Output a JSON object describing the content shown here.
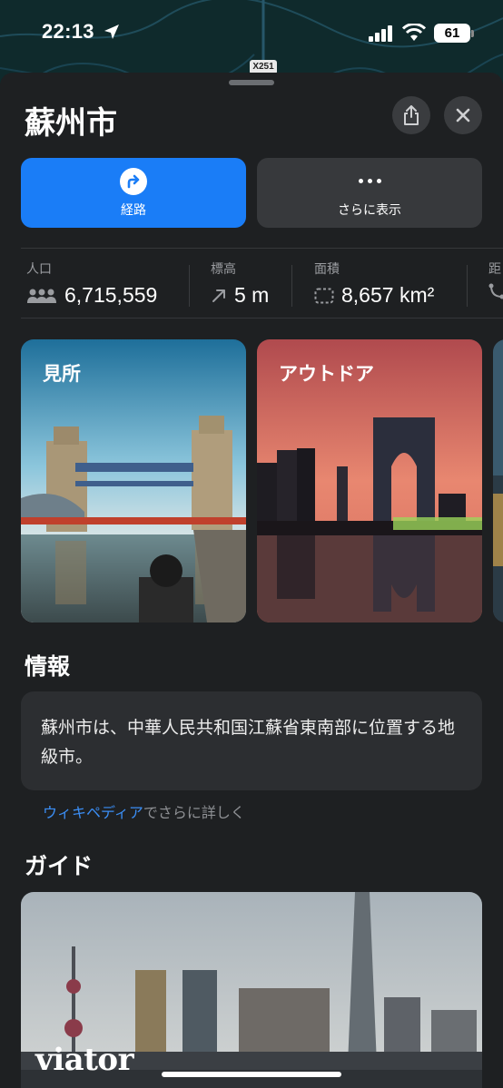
{
  "status_bar": {
    "time": "22:13",
    "battery": "61"
  },
  "map": {
    "route_shield": "X251"
  },
  "place": {
    "name": "蘇州市"
  },
  "actions": {
    "directions_label": "経路",
    "more_label": "さらに表示"
  },
  "stats": [
    {
      "key": "人口",
      "value": "6,715,559",
      "icon": "people-icon"
    },
    {
      "key": "標高",
      "value": "5 m",
      "icon": "elevation-arrow-icon"
    },
    {
      "key": "面積",
      "value": "8,657 km²",
      "icon": "area-icon"
    },
    {
      "key": "距",
      "value": "",
      "icon": "distance-icon"
    }
  ],
  "cards": [
    {
      "caption": "見所"
    },
    {
      "caption": "アウトドア"
    }
  ],
  "info": {
    "heading": "情報",
    "text": "蘇州市は、中華人民共和国江蘇省東南部に位置する地級市。",
    "wiki_link": "ウィキペディア",
    "wiki_suffix": "でさらに詳しく"
  },
  "guide": {
    "heading": "ガイド",
    "brand": "viator"
  },
  "colors": {
    "accent": "#1a7df7",
    "sheet": "#1e2022",
    "link": "#3b8ef5"
  }
}
